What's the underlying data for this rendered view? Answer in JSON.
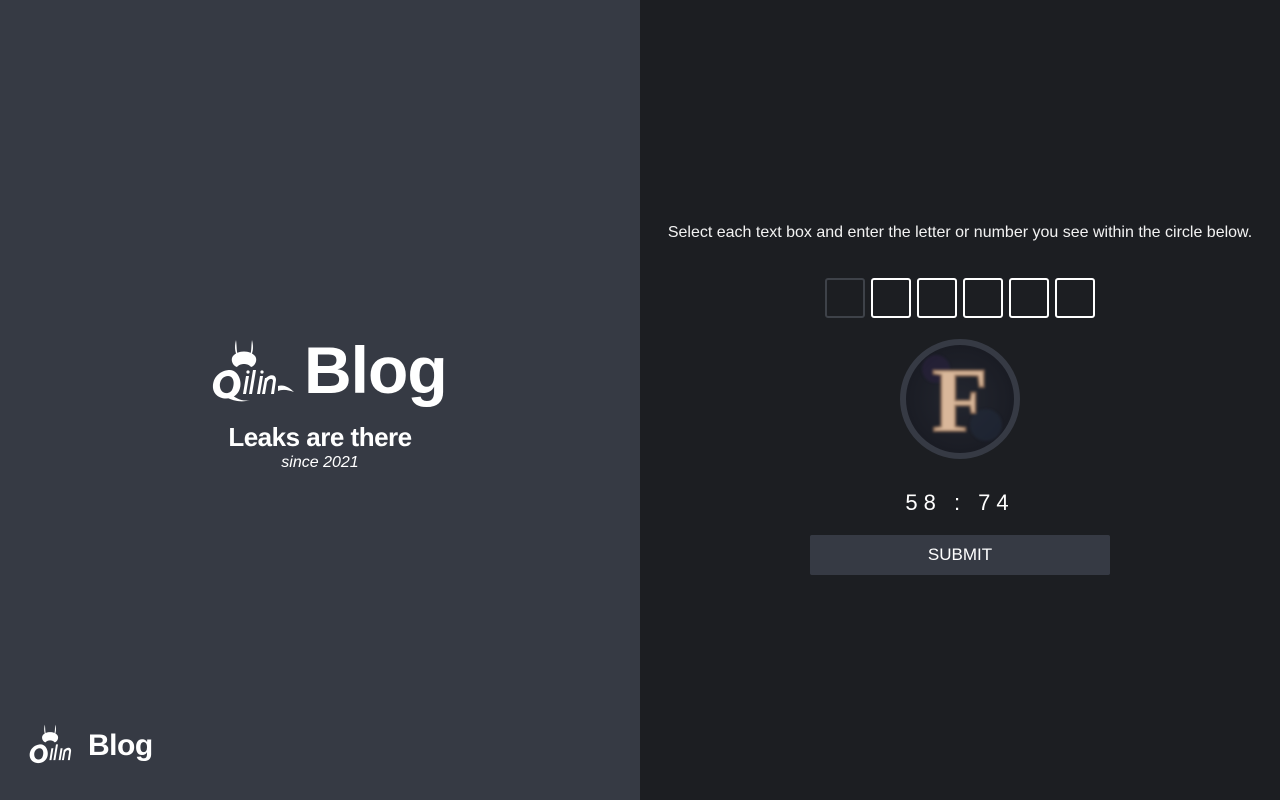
{
  "brand": {
    "blog_word": "Blog",
    "emblem_icon": "qilin-dragon-logo-icon",
    "tagline": "Leaks are there",
    "since": "since 2021"
  },
  "captcha": {
    "instructions": "Select each text box and enter the letter or number you see within the circle below.",
    "boxes": [
      "",
      "",
      "",
      "",
      "",
      ""
    ],
    "image_letter": "F",
    "timer": "58 : 74",
    "submit_label": "SUBMIT"
  },
  "colors": {
    "left_bg": "#363a44",
    "right_bg": "#1c1e22",
    "button_bg": "#363a44",
    "text": "#ffffff"
  }
}
